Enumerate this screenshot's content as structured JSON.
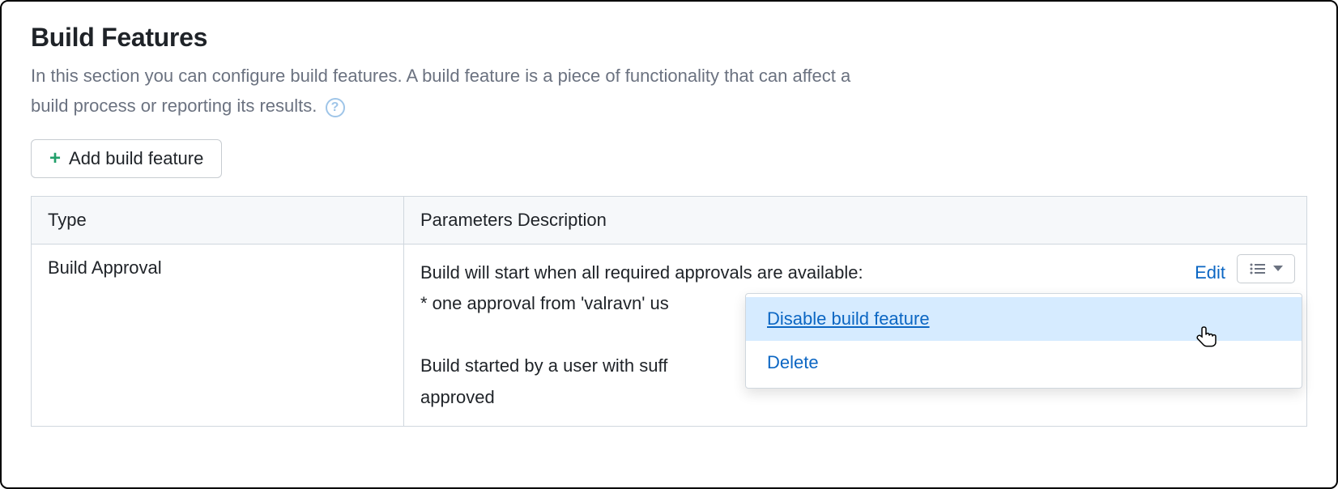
{
  "header": {
    "title": "Build Features",
    "subtitle_1": "In this section you can configure build features. A build feature is a piece of functionality that can affect a",
    "subtitle_2": "build process or reporting its results."
  },
  "buttons": {
    "add_feature": "Add build feature"
  },
  "table": {
    "col_type": "Type",
    "col_params": "Parameters Description",
    "row": {
      "type": "Build Approval",
      "line1": "Build will start when all required approvals are available:",
      "line2": "* one approval from 'valravn' us",
      "line3": "Build started by a user with suff",
      "line4": "approved",
      "edit": "Edit"
    }
  },
  "dropdown": {
    "disable": "Disable build feature",
    "delete": "Delete"
  }
}
